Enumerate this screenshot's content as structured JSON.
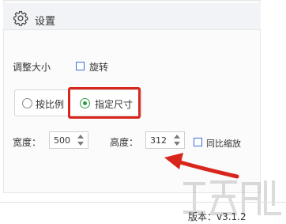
{
  "header": {
    "title": "设置",
    "icon": "gear-icon"
  },
  "resize": {
    "label": "调整大小",
    "rotate_label": "旋转",
    "rotate_checked": false,
    "mode_options": [
      {
        "label": "按比例",
        "selected": false
      },
      {
        "label": "指定尺寸",
        "selected": true
      }
    ]
  },
  "size": {
    "width_label": "宽度：",
    "width_value": "500",
    "height_label": "高度：",
    "height_value": "312",
    "proportional_label": "同比缩放",
    "proportional_checked": false
  },
  "footer": {
    "version": "版本：v3.1.2"
  },
  "colors": {
    "accent_green": "#2f9e44",
    "annotation_red": "#d9261c",
    "checkbox_blue": "#3c6fd6"
  }
}
